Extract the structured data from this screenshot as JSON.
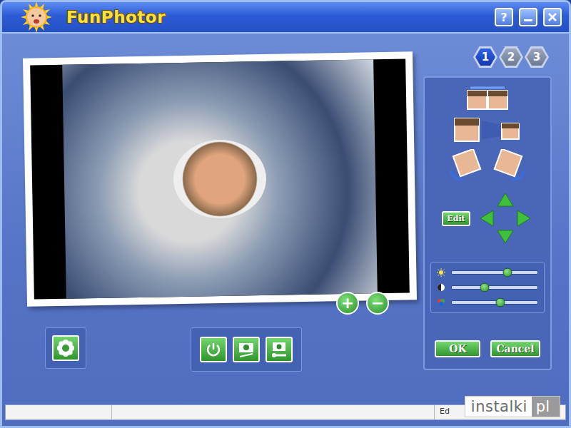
{
  "window": {
    "title": "FunPhotor",
    "help": "?"
  },
  "steps": [
    {
      "label": "1",
      "selected": true
    },
    {
      "label": "2",
      "selected": false
    },
    {
      "label": "3",
      "selected": false
    }
  ],
  "zoom": [
    "+",
    "−"
  ],
  "edit_button": "Edit",
  "sliders": [
    {
      "level": 0.65
    },
    {
      "level": 0.38
    },
    {
      "level": 0.57
    }
  ],
  "buttons": [
    "OK",
    "Cancel"
  ],
  "status_bar": {
    "text": "Ed"
  },
  "watermark": {
    "text": "instalki",
    "suffix": "pl"
  }
}
